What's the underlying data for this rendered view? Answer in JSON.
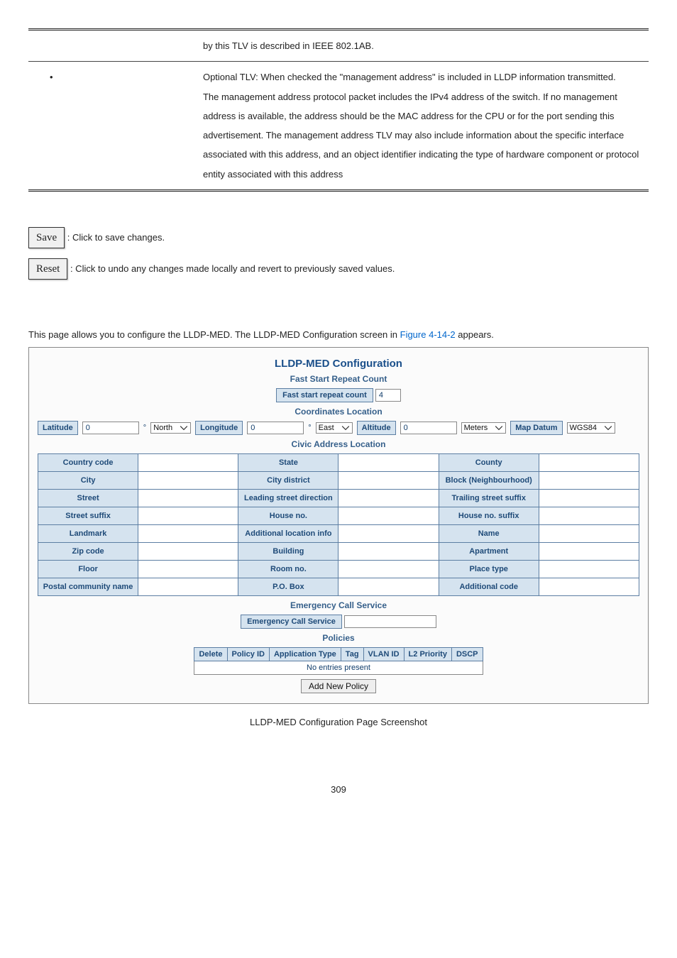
{
  "table": {
    "row1": {
      "cell2": "by this TLV is described in IEEE 802.1AB."
    },
    "row2": {
      "cell2": "Optional TLV: When checked the \"management address\" is included in LLDP information transmitted.\nThe management address protocol packet includes the IPv4 address of the switch. If no management address is available, the address should be the MAC address for the CPU or for the port sending this advertisement. The management address TLV may also include information about the specific interface associated with this address, and an object identifier indicating the type of hardware component or protocol entity associated with this address"
    }
  },
  "buttons": {
    "save": "Save",
    "save_text": ": Click to save changes.",
    "reset": "Reset",
    "reset_text": ": Click to undo any changes made locally and revert to previously saved values."
  },
  "intro": {
    "pre": "This page allows you to configure the LLDP-MED. The LLDP-MED Configuration screen in ",
    "link": "Figure 4-14-2",
    "post": " appears."
  },
  "cfg": {
    "title": "LLDP-MED Configuration",
    "faststart_head": "Fast Start Repeat Count",
    "faststart_label": "Fast start repeat count",
    "faststart_value": "4",
    "coord_head": "Coordinates Location",
    "coord": {
      "latitude_label": "Latitude",
      "latitude_value": "0",
      "deg": "°",
      "north": "North",
      "longitude_label": "Longitude",
      "longitude_value": "0",
      "east": "East",
      "altitude_label": "Altitude",
      "altitude_value": "0",
      "meters": "Meters",
      "mapdatum_label": "Map Datum",
      "mapdatum_value": "WGS84"
    },
    "civic_head": "Civic Address Location",
    "civic": {
      "r0c0": "Country code",
      "r0c2": "State",
      "r0c4": "County",
      "r1c0": "City",
      "r1c2": "City district",
      "r1c4": "Block (Neighbourhood)",
      "r2c0": "Street",
      "r2c2": "Leading street direction",
      "r2c4": "Trailing street suffix",
      "r3c0": "Street suffix",
      "r3c2": "House no.",
      "r3c4": "House no. suffix",
      "r4c0": "Landmark",
      "r4c2": "Additional location info",
      "r4c4": "Name",
      "r5c0": "Zip code",
      "r5c2": "Building",
      "r5c4": "Apartment",
      "r6c0": "Floor",
      "r6c2": "Room no.",
      "r6c4": "Place type",
      "r7c0": "Postal community name",
      "r7c2": "P.O. Box",
      "r7c4": "Additional code"
    },
    "emergency_head": "Emergency Call Service",
    "emergency_label": "Emergency Call Service",
    "policies_head": "Policies",
    "policies": {
      "h0": "Delete",
      "h1": "Policy ID",
      "h2": "Application Type",
      "h3": "Tag",
      "h4": "VLAN ID",
      "h5": "L2 Priority",
      "h6": "DSCP",
      "empty": "No entries present"
    },
    "add_policy": "Add New Policy"
  },
  "caption": "LLDP-MED Configuration Page Screenshot",
  "pagenum": "309"
}
